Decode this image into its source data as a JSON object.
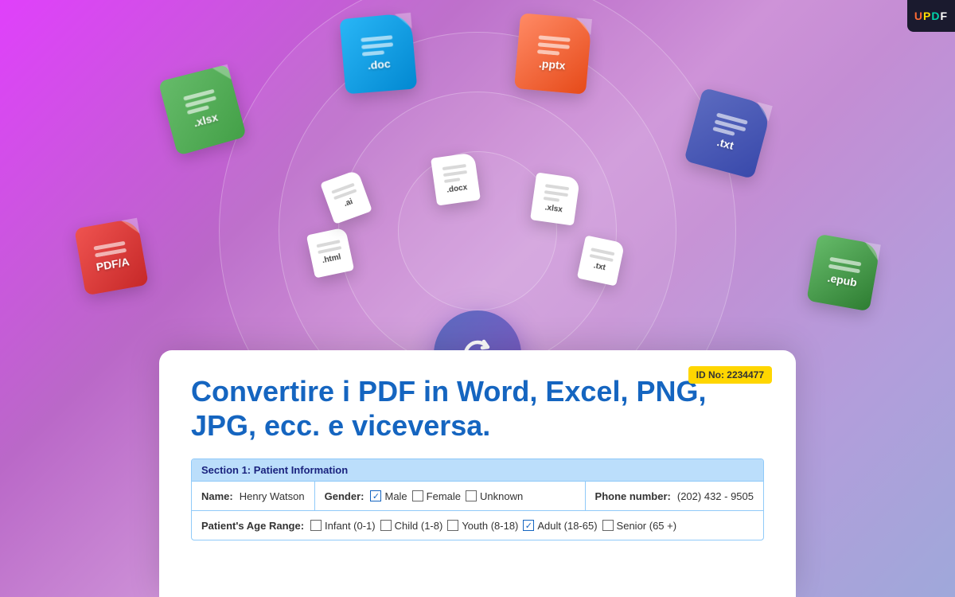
{
  "logo": {
    "letters": [
      "U",
      "P",
      "D",
      "F"
    ]
  },
  "heading": {
    "title": "Convertire i PDF in Word, Excel, PNG, JPG, ecc. e viceversa."
  },
  "id_badge": "ID No: 2234477",
  "file_formats": {
    "large": [
      {
        "label": ".xlsx",
        "color_start": "#66bb6a",
        "color_end": "#43a047"
      },
      {
        "label": ".doc",
        "color_start": "#29b6f6",
        "color_end": "#0288d1"
      },
      {
        "label": ".pptx",
        "color_start": "#ff8a65",
        "color_end": "#e64a19"
      },
      {
        "label": ".txt",
        "color_start": "#5c6bc0",
        "color_end": "#3949ab"
      },
      {
        "label": "PDF/A",
        "color_start": "#ef5350",
        "color_end": "#c62828"
      },
      {
        "label": ".epub",
        "color_start": "#66bb6a",
        "color_end": "#2e7d32"
      }
    ],
    "small": [
      {
        "label": ".docx"
      },
      {
        "label": ".xlsx"
      },
      {
        "label": ".html"
      },
      {
        "label": ".txt"
      },
      {
        "label": ".ai"
      }
    ]
  },
  "form": {
    "section_header": "Section 1: Patient Information",
    "name_label": "Name:",
    "name_value": "Henry Watson",
    "gender_label": "Gender:",
    "gender_options": [
      "Male",
      "Female",
      "Unknown"
    ],
    "gender_checked": "Male",
    "phone_label": "Phone number:",
    "phone_value": "(202) 432 - 9505",
    "age_range_label": "Patient's Age Range:",
    "age_options": [
      "Infant (0-1)",
      "Child (1-8)",
      "Youth (8-18)",
      "Adult (18-65)",
      "Senior (65 +)"
    ],
    "age_checked": "Adult (18-65)"
  }
}
